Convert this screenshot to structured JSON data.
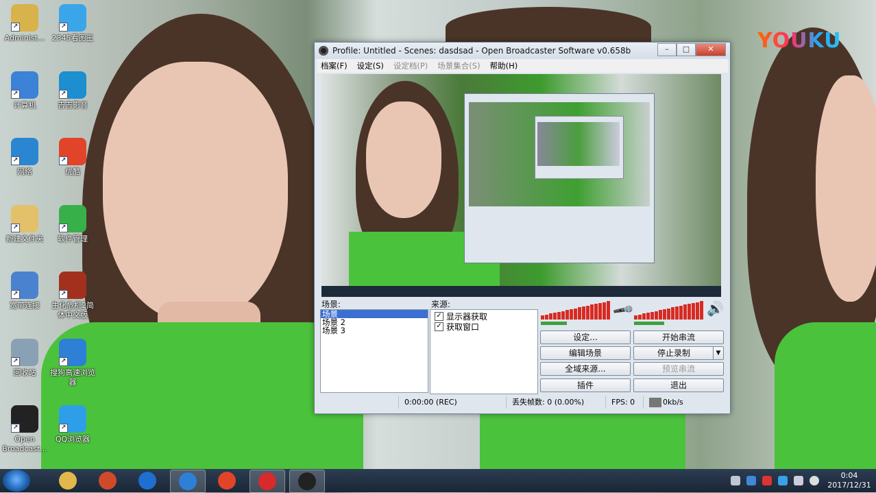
{
  "watermark": {
    "text": "YOUKU"
  },
  "desktop_icons": [
    {
      "label": "Administ...",
      "icon": "user-folder-icon",
      "color": "#d8b24a"
    },
    {
      "label": "2345看图王",
      "icon": "image-viewer-icon",
      "color": "#3aa5e8"
    },
    {
      "label": "计算机",
      "icon": "computer-icon",
      "color": "#3c82d6"
    },
    {
      "label": "吉吉影音",
      "icon": "media-player-icon",
      "color": "#1d8ecf"
    },
    {
      "label": "网络",
      "icon": "network-icon",
      "color": "#2b86d1"
    },
    {
      "label": "优酷",
      "icon": "youku-icon",
      "color": "#e2442a"
    },
    {
      "label": "新建文件夹",
      "icon": "folder-icon",
      "color": "#e3c06a"
    },
    {
      "label": "软件管理",
      "icon": "software-manager-icon",
      "color": "#37b04a"
    },
    {
      "label": "宽带连接",
      "icon": "broadband-icon",
      "color": "#4b82cf"
    },
    {
      "label": "生化危机2简体中文版",
      "icon": "game-icon",
      "color": "#a3301d"
    },
    {
      "label": "回收站",
      "icon": "recycle-bin-icon",
      "color": "#8aa0b4"
    },
    {
      "label": "搜狗高速浏览器",
      "icon": "sogou-browser-icon",
      "color": "#2e7fd6"
    },
    {
      "label": "Open Broadcast...",
      "icon": "obs-icon",
      "color": "#222222"
    },
    {
      "label": "QQ浏览器",
      "icon": "qq-browser-icon",
      "color": "#2f9ee8"
    }
  ],
  "window": {
    "title": "Profile: Untitled - Scenes: dasdsad - Open Broadcaster Software v0.658b",
    "controls": {
      "minimize": "–",
      "maximize": "□",
      "close": "✕"
    },
    "menu": [
      {
        "label": "档案(F)",
        "enabled": true
      },
      {
        "label": "设定(S)",
        "enabled": true
      },
      {
        "label": "设定档(P)",
        "enabled": false
      },
      {
        "label": "场景集合(S)",
        "enabled": false
      },
      {
        "label": "帮助(H)",
        "enabled": true
      }
    ],
    "scenes_label": "场景:",
    "scenes": [
      "场景",
      "场景 2",
      "场景 3"
    ],
    "selected_scene": 0,
    "sources_label": "来源:",
    "sources": [
      {
        "label": "显示器获取",
        "checked": true
      },
      {
        "label": "获取窗口",
        "checked": true
      }
    ],
    "mic_icon": "microphone-icon",
    "speaker_icon": "speaker-icon",
    "buttons": {
      "settings": "设定...",
      "start_stream": "开始串流",
      "edit_scene": "编辑场景",
      "stop_record": "停止录制",
      "global_sources": "全域来源...",
      "preview_stream": "预览串流",
      "plugins": "插件",
      "exit": "退出"
    },
    "status": {
      "time": "0:00:00 (REC)",
      "dropped": "丢失帧数: 0 (0.00%)",
      "fps": "FPS: 0",
      "bitrate": "0kb/s"
    }
  },
  "taskbar": {
    "items": [
      {
        "icon": "explorer-icon",
        "color": "#e2b84a",
        "active": false
      },
      {
        "icon": "software-store-icon",
        "color": "#d04a2a",
        "active": false
      },
      {
        "icon": "kugou-icon",
        "color": "#1f6fd0",
        "active": false
      },
      {
        "icon": "sogou-browser-icon",
        "color": "#2e7fd6",
        "active": true
      },
      {
        "icon": "youku-icon",
        "color": "#e2442a",
        "active": false
      },
      {
        "icon": "red-app-icon",
        "color": "#d72a2a",
        "active": true
      },
      {
        "icon": "obs-icon",
        "color": "#222222",
        "active": true
      }
    ],
    "clock_time": "0:04",
    "clock_date": "2017/12/31"
  }
}
